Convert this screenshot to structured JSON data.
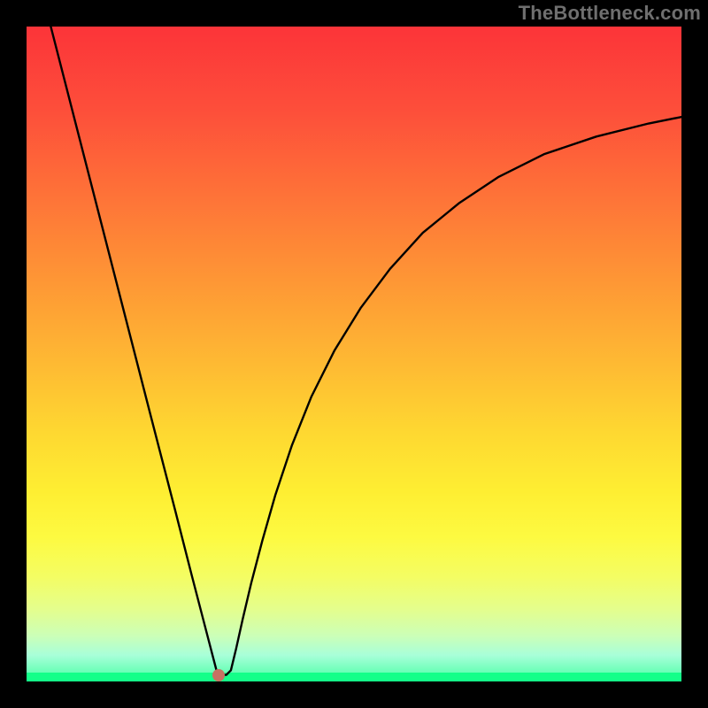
{
  "watermark": "TheBottleneck.com",
  "chart_data": {
    "type": "line",
    "title": "",
    "xlabel": "",
    "ylabel": "",
    "xlim": [
      0,
      1
    ],
    "ylim": [
      0,
      1
    ],
    "background": {
      "type": "vertical-gradient",
      "stops": [
        "#fc3439",
        "#fe9735",
        "#fdfa41",
        "#14ff89"
      ]
    },
    "marker": {
      "x": 0.293,
      "y": 0.01,
      "color": "#c77262"
    },
    "series": [
      {
        "name": "left-branch",
        "x": [
          0.037,
          0.075,
          0.113,
          0.151,
          0.189,
          0.227,
          0.252,
          0.265,
          0.278,
          0.284,
          0.29
        ],
        "y": [
          1.0,
          0.852,
          0.704,
          0.556,
          0.408,
          0.261,
          0.163,
          0.113,
          0.063,
          0.04,
          0.017
        ]
      },
      {
        "name": "valley-floor",
        "x": [
          0.29,
          0.296,
          0.305,
          0.312
        ],
        "y": [
          0.017,
          0.01,
          0.01,
          0.017
        ]
      },
      {
        "name": "right-branch",
        "x": [
          0.312,
          0.32,
          0.33,
          0.343,
          0.36,
          0.38,
          0.405,
          0.435,
          0.47,
          0.51,
          0.555,
          0.605,
          0.66,
          0.72,
          0.79,
          0.87,
          0.95,
          1.0
        ],
        "y": [
          0.017,
          0.05,
          0.095,
          0.15,
          0.215,
          0.285,
          0.36,
          0.435,
          0.505,
          0.57,
          0.63,
          0.685,
          0.73,
          0.77,
          0.805,
          0.832,
          0.852,
          0.862
        ]
      }
    ]
  }
}
